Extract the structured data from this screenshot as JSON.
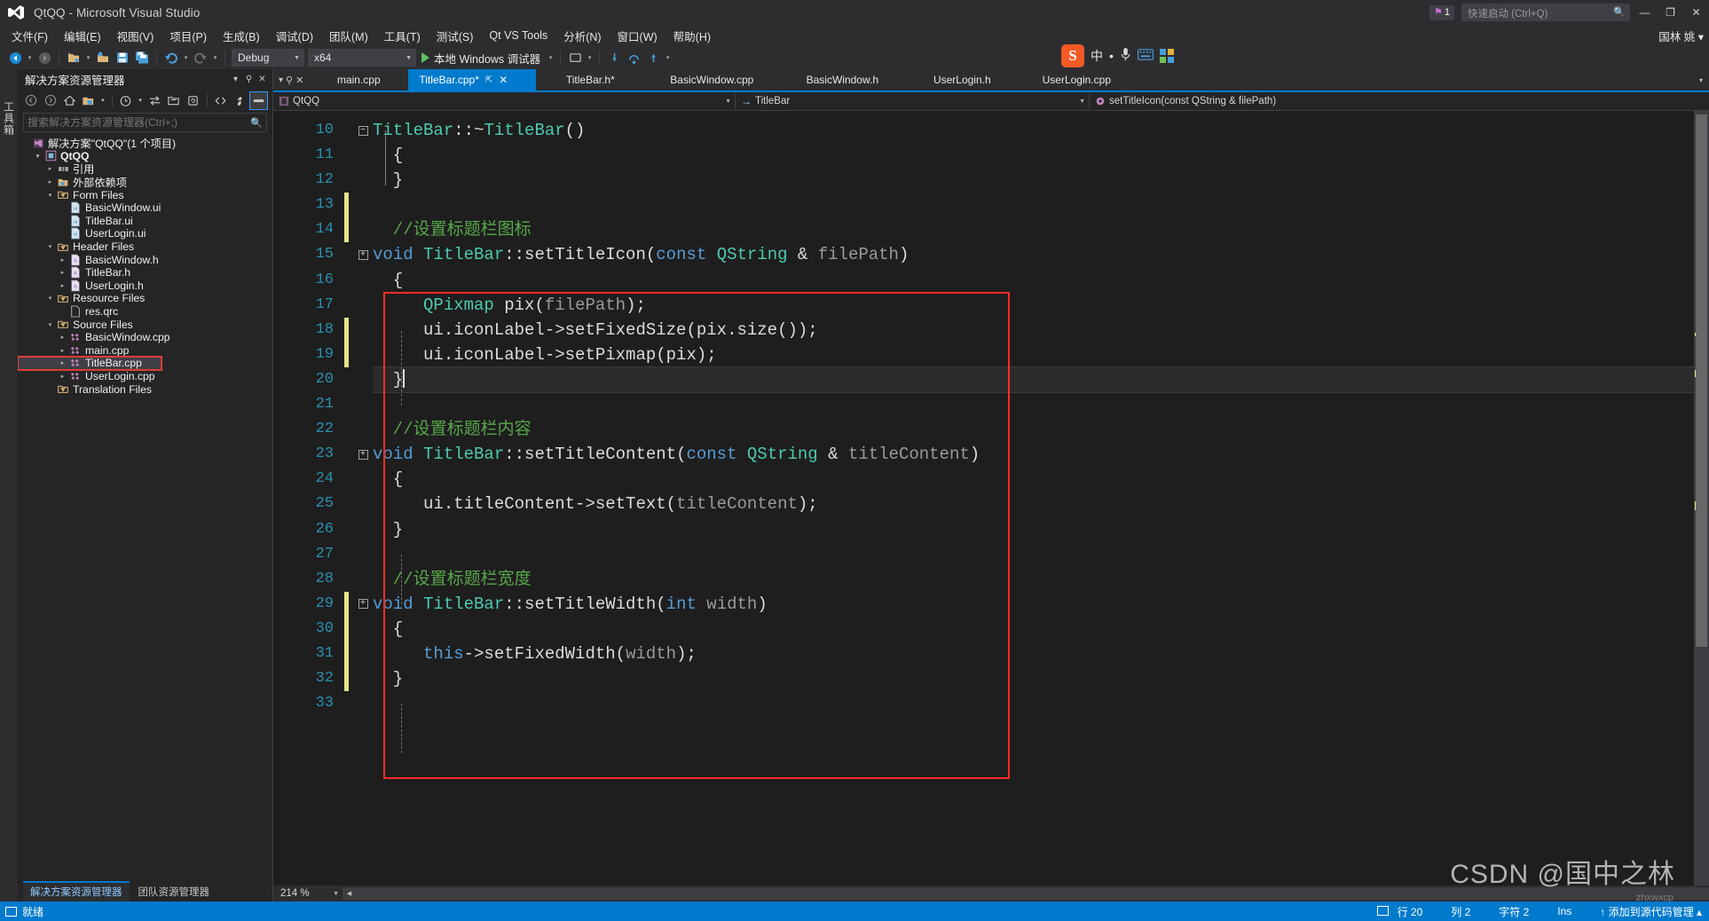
{
  "window": {
    "title": "QtQQ - Microsoft Visual Studio",
    "notification_count": "1",
    "quick_launch_placeholder": "快速启动 (Ctrl+Q)",
    "account": "国林 姚 ▾",
    "minimize": "—",
    "maximize": "❐",
    "close": "✕"
  },
  "menubar": {
    "items": [
      {
        "label": "文件(F)"
      },
      {
        "label": "编辑(E)"
      },
      {
        "label": "视图(V)"
      },
      {
        "label": "项目(P)"
      },
      {
        "label": "生成(B)"
      },
      {
        "label": "调试(D)"
      },
      {
        "label": "团队(M)"
      },
      {
        "label": "工具(T)"
      },
      {
        "label": "测试(S)"
      },
      {
        "label": "Qt VS Tools"
      },
      {
        "label": "分析(N)"
      },
      {
        "label": "窗口(W)"
      },
      {
        "label": "帮助(H)"
      }
    ]
  },
  "toolbar": {
    "configuration": "Debug",
    "platform": "x64",
    "run_label": "本地 Windows 调试器",
    "ime": {
      "logo": "S",
      "lang": "中",
      "dot": "•",
      "mic_icon": "mic-icon",
      "board_icon": "keyboard-icon",
      "apps_icon": "apps-icon"
    }
  },
  "solution_explorer": {
    "title": "解决方案资源管理器",
    "search_placeholder": "搜索解决方案资源管理器(Ctrl+;)",
    "dock_menu": "▾",
    "pin": "⚲",
    "close": "✕",
    "tree": [
      {
        "label": "解决方案\"QtQQ\"(1 个项目)",
        "indent": 0,
        "arrow": "",
        "icon": "solution-icon",
        "bold": false,
        "selected": false,
        "highlight": false
      },
      {
        "label": "QtQQ",
        "indent": 1,
        "arrow": "▾",
        "icon": "project-icon",
        "bold": true,
        "selected": false,
        "highlight": false
      },
      {
        "label": "引用",
        "indent": 2,
        "arrow": "▸",
        "icon": "references-icon",
        "bold": false,
        "selected": false,
        "highlight": false
      },
      {
        "label": "外部依赖项",
        "indent": 2,
        "arrow": "▸",
        "icon": "folder-icon",
        "bold": false,
        "selected": false,
        "highlight": false
      },
      {
        "label": "Form Files",
        "indent": 2,
        "arrow": "▾",
        "icon": "filter-icon",
        "bold": false,
        "selected": false,
        "highlight": false
      },
      {
        "label": "BasicWindow.ui",
        "indent": 3,
        "arrow": "",
        "icon": "ui-file-icon",
        "bold": false,
        "selected": false,
        "highlight": false
      },
      {
        "label": "TitleBar.ui",
        "indent": 3,
        "arrow": "",
        "icon": "ui-file-icon",
        "bold": false,
        "selected": false,
        "highlight": false
      },
      {
        "label": "UserLogin.ui",
        "indent": 3,
        "arrow": "",
        "icon": "ui-file-icon",
        "bold": false,
        "selected": false,
        "highlight": false
      },
      {
        "label": "Header Files",
        "indent": 2,
        "arrow": "▾",
        "icon": "filter-icon",
        "bold": false,
        "selected": false,
        "highlight": false
      },
      {
        "label": "BasicWindow.h",
        "indent": 3,
        "arrow": "▸",
        "icon": "h-file-icon",
        "bold": false,
        "selected": false,
        "highlight": false
      },
      {
        "label": "TitleBar.h",
        "indent": 3,
        "arrow": "▸",
        "icon": "h-file-icon",
        "bold": false,
        "selected": false,
        "highlight": false
      },
      {
        "label": "UserLogin.h",
        "indent": 3,
        "arrow": "▸",
        "icon": "h-file-icon",
        "bold": false,
        "selected": false,
        "highlight": false
      },
      {
        "label": "Resource Files",
        "indent": 2,
        "arrow": "▾",
        "icon": "filter-icon",
        "bold": false,
        "selected": false,
        "highlight": false
      },
      {
        "label": "res.qrc",
        "indent": 3,
        "arrow": "",
        "icon": "generic-file-icon",
        "bold": false,
        "selected": false,
        "highlight": false
      },
      {
        "label": "Source Files",
        "indent": 2,
        "arrow": "▾",
        "icon": "filter-icon",
        "bold": false,
        "selected": false,
        "highlight": false
      },
      {
        "label": "BasicWindow.cpp",
        "indent": 3,
        "arrow": "▸",
        "icon": "cpp-file-icon",
        "bold": false,
        "selected": false,
        "highlight": false
      },
      {
        "label": "main.cpp",
        "indent": 3,
        "arrow": "▸",
        "icon": "cpp-file-icon",
        "bold": false,
        "selected": false,
        "highlight": false
      },
      {
        "label": "TitleBar.cpp",
        "indent": 3,
        "arrow": "▸",
        "icon": "cpp-file-icon",
        "bold": false,
        "selected": true,
        "highlight": true
      },
      {
        "label": "UserLogin.cpp",
        "indent": 3,
        "arrow": "▸",
        "icon": "cpp-file-icon",
        "bold": false,
        "selected": false,
        "highlight": false
      },
      {
        "label": "Translation Files",
        "indent": 2,
        "arrow": "",
        "icon": "filter-icon",
        "bold": false,
        "selected": false,
        "highlight": false
      }
    ],
    "footer_tabs": [
      {
        "label": "解决方案资源管理器",
        "active": true
      },
      {
        "label": "团队资源管理器",
        "active": false
      }
    ]
  },
  "editor": {
    "tabs": [
      {
        "label": "main.cpp",
        "active": false,
        "dirty": false
      },
      {
        "label": "TitleBar.cpp*",
        "active": true,
        "dirty": true
      },
      {
        "label": "TitleBar.h*",
        "active": false,
        "dirty": true
      },
      {
        "label": "BasicWindow.cpp",
        "active": false,
        "dirty": false
      },
      {
        "label": "BasicWindow.h",
        "active": false,
        "dirty": false
      },
      {
        "label": "UserLogin.h",
        "active": false,
        "dirty": false
      },
      {
        "label": "UserLogin.cpp",
        "active": false,
        "dirty": false
      }
    ],
    "tab_pin": "⇱",
    "tab_close": "✕",
    "navbar": {
      "project": "QtQQ",
      "type": "TitleBar",
      "member": "setTitleIcon(const QString & filePath)"
    },
    "zoom": "214 %",
    "first_line": 10,
    "lines": [
      {
        "n": 10,
        "fold": "minus",
        "change": "none",
        "current": false,
        "tokens": [
          {
            "t": "",
            "c": "pl"
          },
          {
            "t": "TitleBar",
            "c": "ty"
          },
          {
            "t": "::~",
            "c": "pl"
          },
          {
            "t": "TitleBar",
            "c": "ty"
          },
          {
            "t": "()",
            "c": "pl"
          }
        ]
      },
      {
        "n": 11,
        "fold": "",
        "change": "none",
        "current": false,
        "tokens": [
          {
            "t": "  {",
            "c": "pl"
          }
        ]
      },
      {
        "n": 12,
        "fold": "",
        "change": "none",
        "current": false,
        "tokens": [
          {
            "t": "  }",
            "c": "pl"
          }
        ]
      },
      {
        "n": 13,
        "fold": "",
        "change": "yellow",
        "current": false,
        "tokens": [
          {
            "t": "",
            "c": "pl"
          }
        ]
      },
      {
        "n": 14,
        "fold": "",
        "change": "yellow",
        "current": false,
        "tokens": [
          {
            "t": "  //设置标题栏图标",
            "c": "cm"
          }
        ]
      },
      {
        "n": 15,
        "fold": "plus",
        "change": "none",
        "current": false,
        "tokens": [
          {
            "t": "void",
            "c": "kw"
          },
          {
            "t": " ",
            "c": "pl"
          },
          {
            "t": "TitleBar",
            "c": "ty"
          },
          {
            "t": "::setTitleIcon(",
            "c": "pl"
          },
          {
            "t": "const",
            "c": "kw"
          },
          {
            "t": " ",
            "c": "pl"
          },
          {
            "t": "QString",
            "c": "ty"
          },
          {
            "t": " & ",
            "c": "pl"
          },
          {
            "t": "filePath",
            "c": "pa"
          },
          {
            "t": ")",
            "c": "pl"
          }
        ]
      },
      {
        "n": 16,
        "fold": "",
        "change": "none",
        "current": false,
        "tokens": [
          {
            "t": "  {",
            "c": "pl"
          }
        ]
      },
      {
        "n": 17,
        "fold": "",
        "change": "none",
        "current": false,
        "tokens": [
          {
            "t": "     ",
            "c": "pl"
          },
          {
            "t": "QPixmap",
            "c": "ty"
          },
          {
            "t": " pix(",
            "c": "pl"
          },
          {
            "t": "filePath",
            "c": "pa"
          },
          {
            "t": ");",
            "c": "pl"
          }
        ]
      },
      {
        "n": 18,
        "fold": "",
        "change": "yellow",
        "current": false,
        "tokens": [
          {
            "t": "     ui.iconLabel->setFixedSize(pix.size());",
            "c": "pl"
          }
        ]
      },
      {
        "n": 19,
        "fold": "",
        "change": "yellow",
        "current": false,
        "tokens": [
          {
            "t": "     ui.iconLabel->setPixmap(pix);",
            "c": "pl"
          }
        ]
      },
      {
        "n": 20,
        "fold": "",
        "change": "none",
        "current": true,
        "tokens": [
          {
            "t": "  }",
            "c": "pl"
          }
        ]
      },
      {
        "n": 21,
        "fold": "",
        "change": "none",
        "current": false,
        "tokens": [
          {
            "t": "",
            "c": "pl"
          }
        ]
      },
      {
        "n": 22,
        "fold": "",
        "change": "none",
        "current": false,
        "tokens": [
          {
            "t": "  //设置标题栏内容",
            "c": "cm"
          }
        ]
      },
      {
        "n": 23,
        "fold": "plus",
        "change": "none",
        "current": false,
        "tokens": [
          {
            "t": "void",
            "c": "kw"
          },
          {
            "t": " ",
            "c": "pl"
          },
          {
            "t": "TitleBar",
            "c": "ty"
          },
          {
            "t": "::setTitleContent(",
            "c": "pl"
          },
          {
            "t": "const",
            "c": "kw"
          },
          {
            "t": " ",
            "c": "pl"
          },
          {
            "t": "QString",
            "c": "ty"
          },
          {
            "t": " & ",
            "c": "pl"
          },
          {
            "t": "titleContent",
            "c": "pa"
          },
          {
            "t": ")",
            "c": "pl"
          }
        ]
      },
      {
        "n": 24,
        "fold": "",
        "change": "none",
        "current": false,
        "tokens": [
          {
            "t": "  {",
            "c": "pl"
          }
        ]
      },
      {
        "n": 25,
        "fold": "",
        "change": "none",
        "current": false,
        "tokens": [
          {
            "t": "     ui.titleContent->setText(",
            "c": "pl"
          },
          {
            "t": "titleContent",
            "c": "pa"
          },
          {
            "t": ");",
            "c": "pl"
          }
        ]
      },
      {
        "n": 26,
        "fold": "",
        "change": "none",
        "current": false,
        "tokens": [
          {
            "t": "  }",
            "c": "pl"
          }
        ]
      },
      {
        "n": 27,
        "fold": "",
        "change": "none",
        "current": false,
        "tokens": [
          {
            "t": "",
            "c": "pl"
          }
        ]
      },
      {
        "n": 28,
        "fold": "",
        "change": "none",
        "current": false,
        "tokens": [
          {
            "t": "  //设置标题栏宽度",
            "c": "cm"
          }
        ]
      },
      {
        "n": 29,
        "fold": "plus",
        "change": "yellow",
        "current": false,
        "tokens": [
          {
            "t": "void",
            "c": "kw"
          },
          {
            "t": " ",
            "c": "pl"
          },
          {
            "t": "TitleBar",
            "c": "ty"
          },
          {
            "t": "::setTitleWidth(",
            "c": "pl"
          },
          {
            "t": "int",
            "c": "kw"
          },
          {
            "t": " ",
            "c": "pl"
          },
          {
            "t": "width",
            "c": "pa"
          },
          {
            "t": ")",
            "c": "pl"
          }
        ]
      },
      {
        "n": 30,
        "fold": "",
        "change": "yellow",
        "current": false,
        "tokens": [
          {
            "t": "  {",
            "c": "pl"
          }
        ]
      },
      {
        "n": 31,
        "fold": "",
        "change": "yellow",
        "current": false,
        "tokens": [
          {
            "t": "     ",
            "c": "pl"
          },
          {
            "t": "this",
            "c": "kw"
          },
          {
            "t": "->setFixedWidth(",
            "c": "pl"
          },
          {
            "t": "width",
            "c": "pa"
          },
          {
            "t": ");",
            "c": "pl"
          }
        ]
      },
      {
        "n": 32,
        "fold": "",
        "change": "yellow",
        "current": false,
        "tokens": [
          {
            "t": "  }",
            "c": "pl"
          }
        ]
      },
      {
        "n": 33,
        "fold": "",
        "change": "none",
        "current": false,
        "tokens": [
          {
            "t": "",
            "c": "pl"
          }
        ]
      }
    ]
  },
  "statusbar": {
    "ready": "就绪",
    "line_label": "行 20",
    "col_label": "列 2",
    "char_label": "字符 2",
    "insert_mode": "Ins",
    "publish": "↑ 添加到源代码管理 ▴"
  },
  "watermark": {
    "main": "CSDN @国中之林",
    "sub": "zhxwxcp"
  },
  "colors": {
    "accent": "#007acc",
    "highlight_box": "#fb2c26",
    "comment": "#57a64a",
    "keyword": "#569cd6",
    "type": "#4ec9b0",
    "linenum": "#2b91af",
    "change_bar": "#e5e58a"
  }
}
